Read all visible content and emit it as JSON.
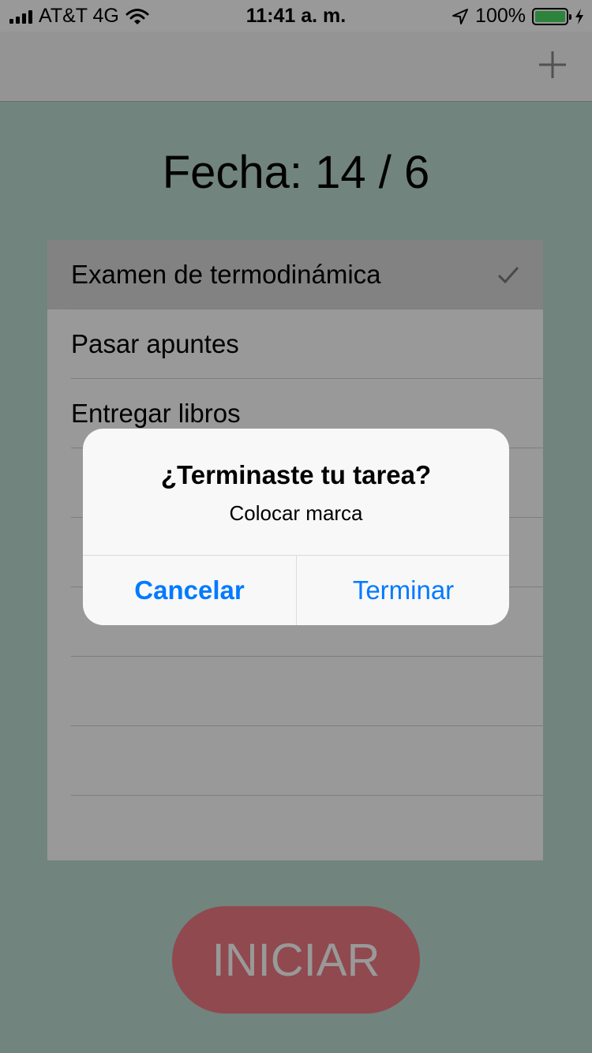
{
  "status_bar": {
    "carrier": "AT&T 4G",
    "time": "11:41 a. m.",
    "battery_percent": "100%",
    "battery_level": 1.0,
    "battery_color": "#4cd964"
  },
  "nav": {
    "add_icon": "plus-icon"
  },
  "header": {
    "date_label": "Fecha: 14 / 6"
  },
  "tasks": [
    {
      "label": "Examen de termodinámica",
      "checked": true,
      "selected": true
    },
    {
      "label": "Pasar apuntes",
      "checked": false,
      "selected": false
    },
    {
      "label": "Entregar libros",
      "checked": false,
      "selected": false
    },
    {
      "label": "",
      "checked": false,
      "selected": false
    },
    {
      "label": "",
      "checked": false,
      "selected": false
    },
    {
      "label": "",
      "checked": false,
      "selected": false
    },
    {
      "label": "",
      "checked": false,
      "selected": false
    },
    {
      "label": "",
      "checked": false,
      "selected": false
    },
    {
      "label": "",
      "checked": false,
      "selected": false
    }
  ],
  "start_button": {
    "label": "INICIAR",
    "color": "#f07a82"
  },
  "alert": {
    "title": "¿Terminaste tu tarea?",
    "message": "Colocar marca",
    "cancel_label": "Cancelar",
    "confirm_label": "Terminar",
    "button_color": "#007aff"
  },
  "colors": {
    "background": "#bcdcd0",
    "overlay": "rgba(0,0,0,0.40)"
  }
}
